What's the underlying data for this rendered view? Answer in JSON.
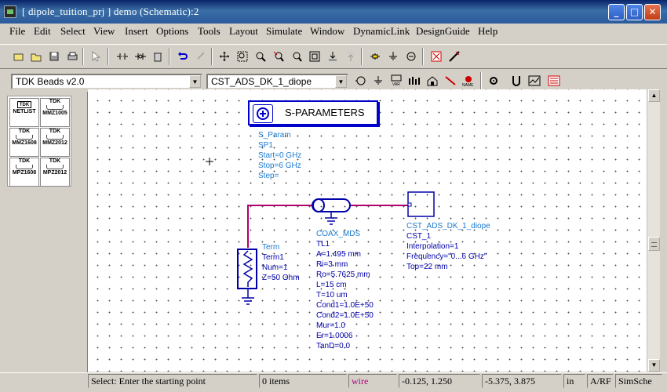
{
  "window": {
    "title": "[ dipole_tuition_prj ] demo (Schematic):2",
    "min_glyph": "_",
    "max_glyph": "□",
    "close_glyph": "✕"
  },
  "menu": [
    "File",
    "Edit",
    "Select",
    "View",
    "Insert",
    "Options",
    "Tools",
    "Layout",
    "Simulate",
    "Window",
    "DynamicLink",
    "DesignGuide",
    "Help"
  ],
  "toolbar": {
    "library_combo": "TDK Beads v2.0",
    "component_combo": "CST_ADS_DK_1_diope"
  },
  "palette": {
    "items": [
      {
        "logo": "TDK",
        "label": "NETLIST"
      },
      {
        "logo": "TDK",
        "label": "MMZ1005"
      },
      {
        "logo": "TDK",
        "label": "MMZ1608"
      },
      {
        "logo": "TDK",
        "label": "MMZ2012"
      },
      {
        "logo": "TDK",
        "label": "MPZ1608"
      },
      {
        "logo": "TDK",
        "label": "MPZ2012"
      }
    ]
  },
  "schematic": {
    "sparam_title": "S-PARAMETERS",
    "sparam_lines": "S_Param\nSP1\nStart=0 GHz\nStop=6 GHz\nStep=",
    "term_name": "Term",
    "term_lines": "Term1\nNum=1\nZ=50 Ohm",
    "coax_name": "COAX_MDS",
    "coax_lines": "TL1\nA=1.495 mm\nRi=3 mm\nRo=5.7625 mm\nL=15 cm\nT=10 um\nCond1=1.0E+50\nCond2=1.0E+50\nMur=1.0\nEr=1.0006\nTanD=0.0",
    "cst_name": "CST_ADS_DK_1_diope",
    "cst_lines": "CST_1\nInterpolation=1\nFrequency=\"0...6 GHz\"\nTop=22 mm",
    "colors": {
      "wire": "#b0006e",
      "component": "#0000aa",
      "label": "#1a7ad0"
    }
  },
  "status": {
    "prompt": "Select: Enter the starting point",
    "items": "0 items",
    "mode": "wire",
    "coord1": "-0.125, 1.250",
    "coord2": "-5.375, 3.875",
    "unit": "in",
    "layer": "A/RF",
    "sim": "SimSche"
  }
}
